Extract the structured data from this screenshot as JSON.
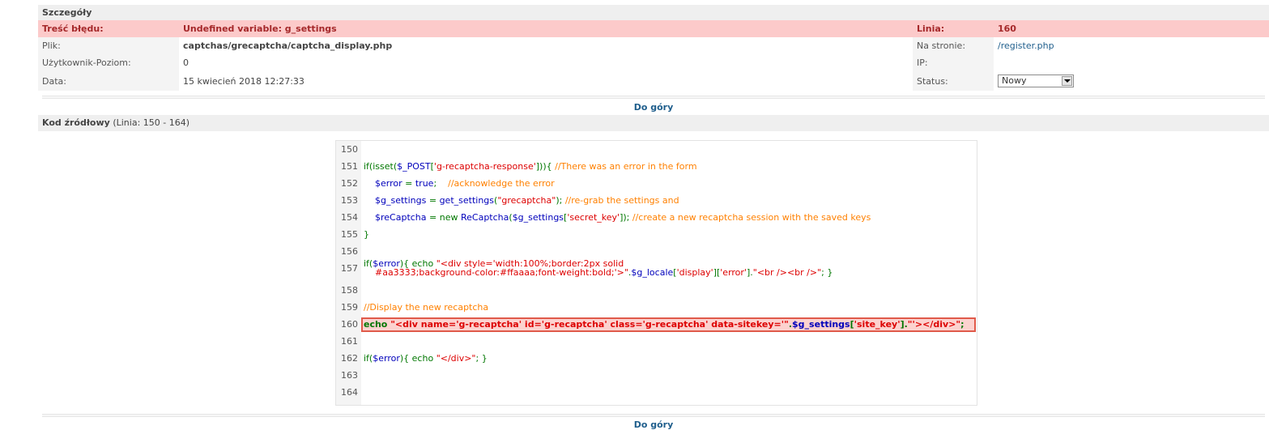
{
  "details": {
    "header": "Szczegóły",
    "error_label": "Treść błędu:",
    "error_value": "Undefined variable: g_settings",
    "line_label": "Linia:",
    "line_value": "160",
    "file_label": "Plik:",
    "file_value": "captchas/grecaptcha/captcha_display.php",
    "page_label": "Na stronie:",
    "page_value": "/register.php",
    "user_label": "Użytkownik-Poziom:",
    "user_value": "0",
    "ip_label": "IP:",
    "ip_value": "",
    "date_label": "Data:",
    "date_value": "15 kwiecień 2018 12:27:33",
    "status_label": "Status:",
    "status_selected": "Nowy"
  },
  "nav": {
    "top_link": "Do góry"
  },
  "source": {
    "title": "Kod źródłowy",
    "range": "(Linia: 150 - 164)",
    "highlight_line": 160,
    "lines": [
      {
        "n": "150",
        "parts": []
      },
      {
        "n": "151",
        "parts": [
          {
            "t": "if(isset(",
            "c": "kw"
          },
          {
            "t": "$_POST",
            "c": "var"
          },
          {
            "t": "[",
            "c": "kw"
          },
          {
            "t": "'g-recaptcha-response'",
            "c": "str"
          },
          {
            "t": "])){ ",
            "c": "kw"
          },
          {
            "t": "//There was an error in the form",
            "c": "com"
          }
        ]
      },
      {
        "n": "152",
        "parts": [
          {
            "t": "    ",
            "c": "kw"
          },
          {
            "t": "$error",
            "c": "var"
          },
          {
            "t": " = ",
            "c": "kw"
          },
          {
            "t": "true",
            "c": "var"
          },
          {
            "t": ";    ",
            "c": "kw"
          },
          {
            "t": "//acknowledge the error",
            "c": "com"
          }
        ]
      },
      {
        "n": "153",
        "parts": [
          {
            "t": "    ",
            "c": "kw"
          },
          {
            "t": "$g_settings",
            "c": "var"
          },
          {
            "t": " = ",
            "c": "kw"
          },
          {
            "t": "get_settings",
            "c": "var"
          },
          {
            "t": "(",
            "c": "kw"
          },
          {
            "t": "\"grecaptcha\"",
            "c": "str"
          },
          {
            "t": "); ",
            "c": "kw"
          },
          {
            "t": "//re-grab the settings and",
            "c": "com"
          }
        ]
      },
      {
        "n": "154",
        "parts": [
          {
            "t": "    ",
            "c": "kw"
          },
          {
            "t": "$reCaptcha",
            "c": "var"
          },
          {
            "t": " = new ",
            "c": "kw"
          },
          {
            "t": "ReCaptcha",
            "c": "var"
          },
          {
            "t": "(",
            "c": "kw"
          },
          {
            "t": "$g_settings",
            "c": "var"
          },
          {
            "t": "[",
            "c": "kw"
          },
          {
            "t": "'secret_key'",
            "c": "str"
          },
          {
            "t": "]); ",
            "c": "kw"
          },
          {
            "t": "//create a new recaptcha session with the saved keys",
            "c": "com"
          }
        ]
      },
      {
        "n": "155",
        "parts": [
          {
            "t": "}",
            "c": "kw"
          }
        ]
      },
      {
        "n": "156",
        "parts": []
      },
      {
        "n": "157",
        "parts": [
          {
            "t": "if(",
            "c": "kw"
          },
          {
            "t": "$error",
            "c": "var"
          },
          {
            "t": "){ echo ",
            "c": "kw"
          },
          {
            "t": "\"<div style='width:100%;border:2px solid",
            "c": "str"
          }
        ],
        "cont": [
          {
            "t": "    #aa3333;background-color:#ffaaaa;font-weight:bold;'>\"",
            "c": "str"
          },
          {
            "t": ".",
            "c": "kw"
          },
          {
            "t": "$g_locale",
            "c": "var"
          },
          {
            "t": "[",
            "c": "kw"
          },
          {
            "t": "'display'",
            "c": "str"
          },
          {
            "t": "][",
            "c": "kw"
          },
          {
            "t": "'error'",
            "c": "str"
          },
          {
            "t": "].",
            "c": "kw"
          },
          {
            "t": "\"<br /><br />\"",
            "c": "str"
          },
          {
            "t": "; }",
            "c": "kw"
          }
        ]
      },
      {
        "n": "158",
        "parts": []
      },
      {
        "n": "159",
        "parts": [
          {
            "t": "//Display the new recaptcha",
            "c": "com"
          }
        ]
      },
      {
        "n": "160",
        "parts": [
          {
            "t": "echo ",
            "c": "kw"
          },
          {
            "t": "\"<div name='g-recaptcha' id='g-recaptcha' class='g-recaptcha' data-sitekey='\"",
            "c": "str"
          },
          {
            "t": ".",
            "c": "kw"
          },
          {
            "t": "$g_settings",
            "c": "var"
          },
          {
            "t": "[",
            "c": "kw"
          },
          {
            "t": "'site_key'",
            "c": "str"
          },
          {
            "t": "].",
            "c": "kw"
          },
          {
            "t": "\"'></div>\"",
            "c": "str"
          },
          {
            "t": ";",
            "c": "kw"
          }
        ]
      },
      {
        "n": "161",
        "parts": []
      },
      {
        "n": "162",
        "parts": [
          {
            "t": "if(",
            "c": "kw"
          },
          {
            "t": "$error",
            "c": "var"
          },
          {
            "t": "){ echo ",
            "c": "kw"
          },
          {
            "t": "\"</div>\"",
            "c": "str"
          },
          {
            "t": "; }",
            "c": "kw"
          }
        ]
      },
      {
        "n": "163",
        "parts": []
      },
      {
        "n": "164",
        "parts": []
      }
    ]
  }
}
